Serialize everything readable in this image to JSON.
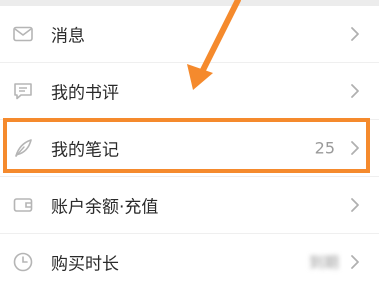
{
  "menu": {
    "items": [
      {
        "label": "消息",
        "icon": "mail-icon"
      },
      {
        "label": "我的书评",
        "icon": "comment-icon"
      },
      {
        "label": "我的笔记",
        "icon": "feather-pen-icon",
        "count": "25"
      },
      {
        "label": "账户余额·充值",
        "icon": "wallet-icon"
      },
      {
        "label": "购买时长",
        "icon": "clock-icon",
        "trailing": "到期"
      }
    ]
  },
  "annotation": {
    "highlight_color": "#f58a2d",
    "highlighted_item": "我的笔记"
  }
}
